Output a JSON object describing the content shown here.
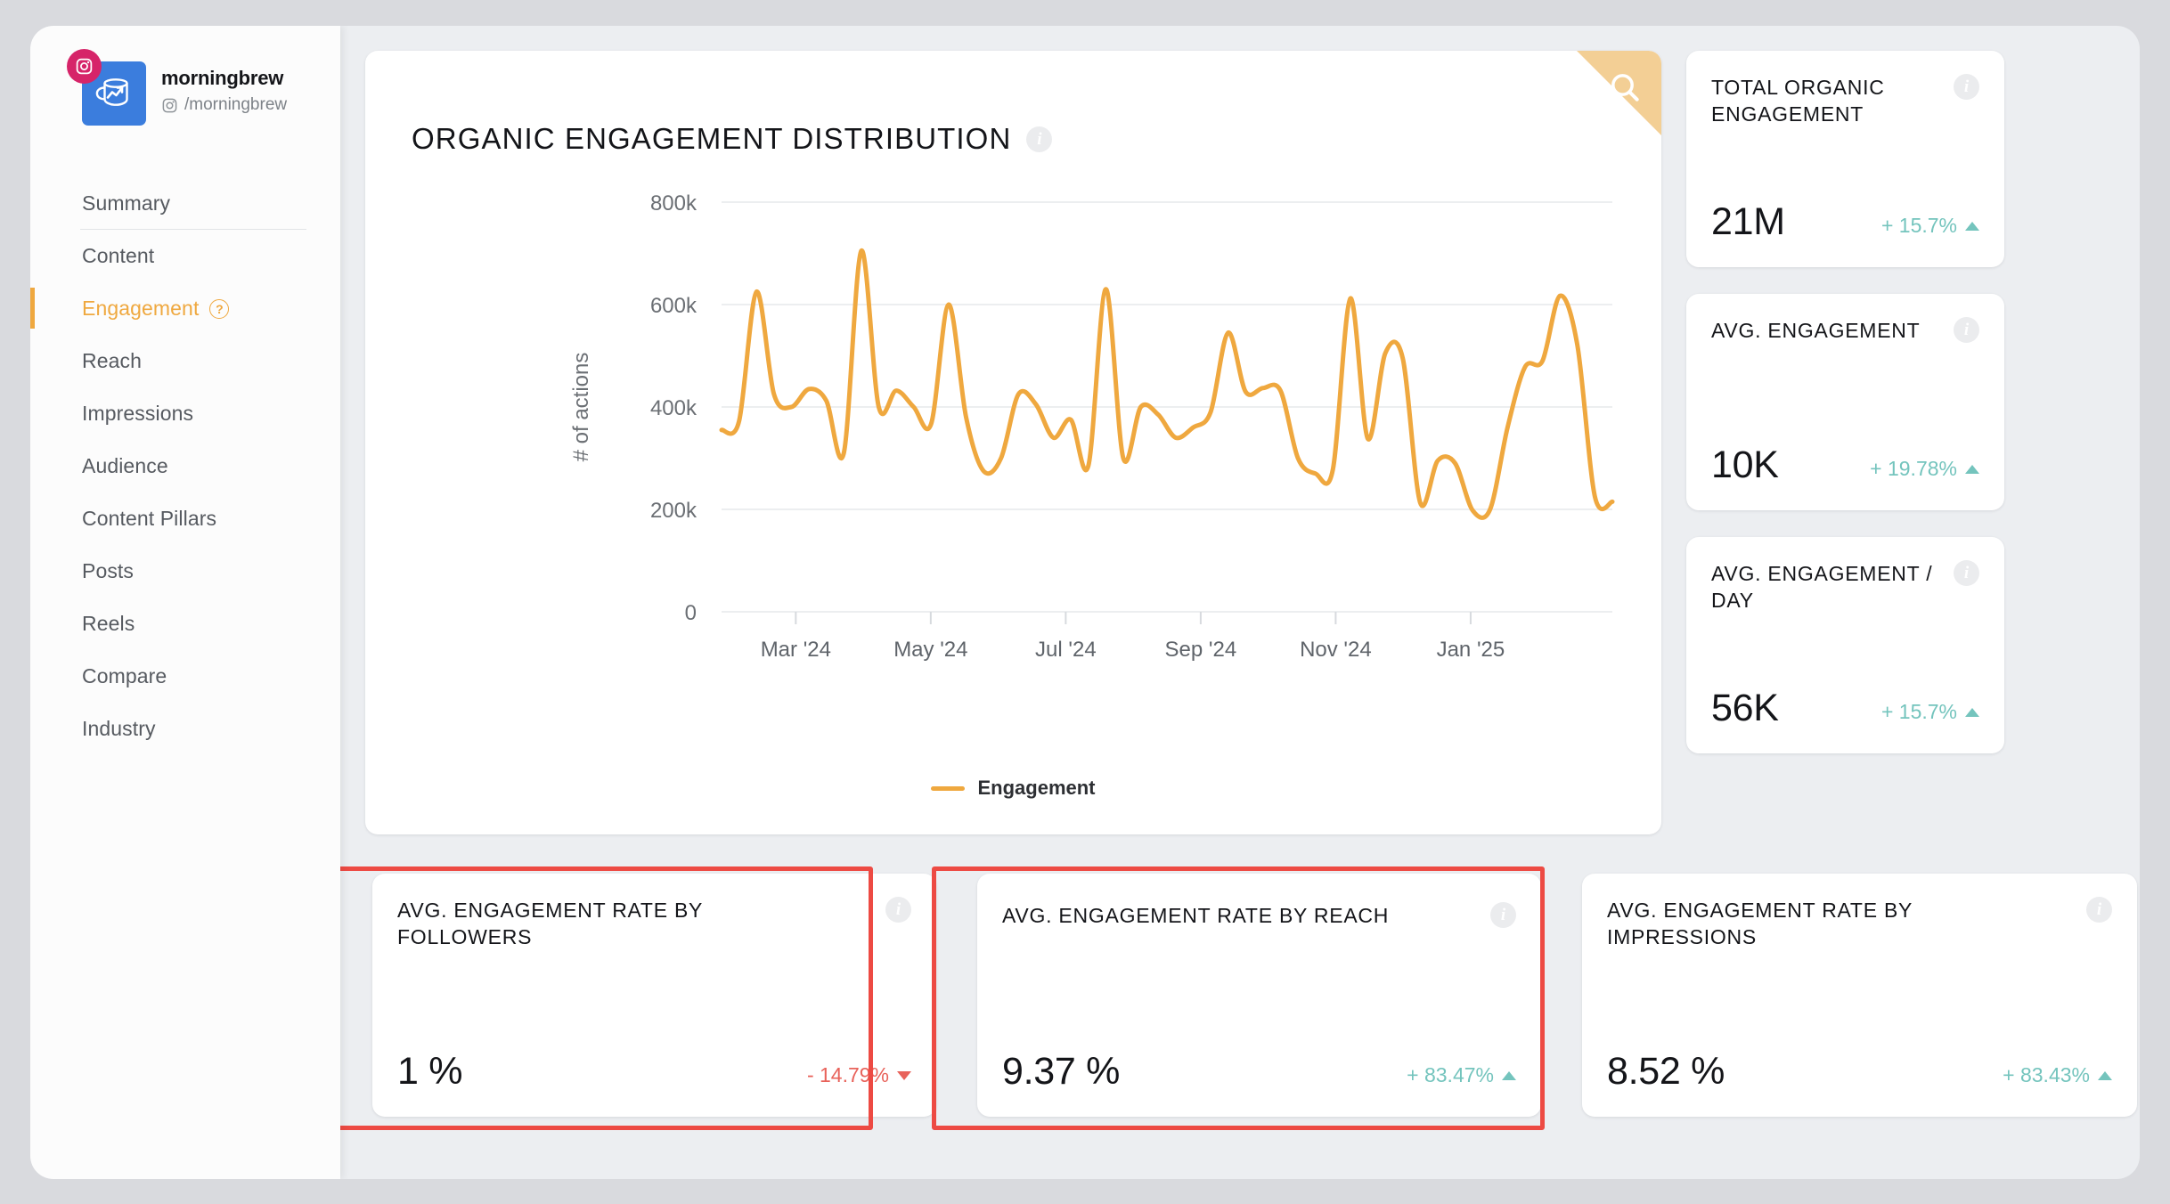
{
  "sidebar": {
    "brand": {
      "name": "morningbrew",
      "handle": "/morningbrew",
      "network_badge_icon": "instagram-icon",
      "avatar_icon": "mug-chart-logo-icon"
    },
    "items": [
      {
        "label": "Summary",
        "active": false
      },
      {
        "label": "Content",
        "active": false
      },
      {
        "label": "Engagement",
        "active": true,
        "help": "?"
      },
      {
        "label": "Reach",
        "active": false
      },
      {
        "label": "Impressions",
        "active": false
      },
      {
        "label": "Audience",
        "active": false
      },
      {
        "label": "Content Pillars",
        "active": false
      },
      {
        "label": "Posts",
        "active": false
      },
      {
        "label": "Reels",
        "active": false
      },
      {
        "label": "Compare",
        "active": false
      },
      {
        "label": "Industry",
        "active": false
      }
    ]
  },
  "chart_card": {
    "title": "ORGANIC ENGAGEMENT DISTRIBUTION",
    "info_icon": "info-icon",
    "search_icon": "search-icon"
  },
  "chart_data": {
    "type": "line",
    "title": "ORGANIC ENGAGEMENT DISTRIBUTION",
    "xlabel": "",
    "ylabel": "# of actions",
    "ylim": [
      0,
      800000
    ],
    "ytick_labels": [
      "0",
      "200k",
      "400k",
      "600k",
      "800k"
    ],
    "ytick_values": [
      0,
      200000,
      400000,
      600000,
      800000
    ],
    "xtick_labels": [
      "Mar '24",
      "May '24",
      "Jul '24",
      "Sep '24",
      "Nov '24",
      "Jan '25"
    ],
    "grid": true,
    "legend": [
      {
        "name": "Engagement",
        "color": "#efa83f"
      }
    ],
    "legend_position": "bottom",
    "line_color": "#efa83f",
    "series": [
      {
        "name": "Engagement",
        "values": [
          355000,
          372000,
          625000,
          425000,
          400000,
          435000,
          412000,
          310000,
          705000,
          400000,
          432000,
          400000,
          367000,
          600000,
          380000,
          275000,
          300000,
          425000,
          405000,
          340000,
          375000,
          285000,
          630000,
          300000,
          400000,
          385000,
          340000,
          360000,
          390000,
          545000,
          430000,
          437000,
          432000,
          300000,
          270000,
          278000,
          612000,
          338000,
          505000,
          495000,
          213000,
          295000,
          290000,
          198000,
          200000,
          360000,
          478000,
          490000,
          617000,
          520000,
          225000,
          215000
        ]
      }
    ]
  },
  "kpi_cards": [
    {
      "title": "TOTAL ORGANIC ENGAGEMENT",
      "value": "21M",
      "delta": "+ 15.7%",
      "direction": "up",
      "info_icon": "info-icon"
    },
    {
      "title": "AVG. ENGAGEMENT",
      "value": "10K",
      "delta": "+ 19.78%",
      "direction": "up",
      "info_icon": "info-icon"
    },
    {
      "title": "AVG. ENGAGEMENT / DAY",
      "value": "56K",
      "delta": "+ 15.7%",
      "direction": "up",
      "info_icon": "info-icon"
    }
  ],
  "bottom_cards": [
    {
      "title": "AVG. ENGAGEMENT RATE BY FOLLOWERS",
      "value": "1 %",
      "delta": "- 14.79%",
      "direction": "down",
      "highlighted": true,
      "info_icon": "info-icon"
    },
    {
      "title": "AVG. ENGAGEMENT RATE BY REACH",
      "value": "9.37 %",
      "delta": "+ 83.47%",
      "direction": "up",
      "highlighted": true,
      "info_icon": "info-icon"
    },
    {
      "title": "AVG. ENGAGEMENT RATE BY IMPRESSIONS",
      "value": "8.52 %",
      "delta": "+ 83.43%",
      "direction": "up",
      "highlighted": false,
      "info_icon": "info-icon"
    }
  ],
  "colors": {
    "accent_orange": "#efa83f",
    "positive_teal": "#74c4bd",
    "negative_red": "#e8625a",
    "highlight_red": "#ed4a43",
    "brand_blue": "#3b7ddd",
    "instagram_pink": "#d62469"
  }
}
